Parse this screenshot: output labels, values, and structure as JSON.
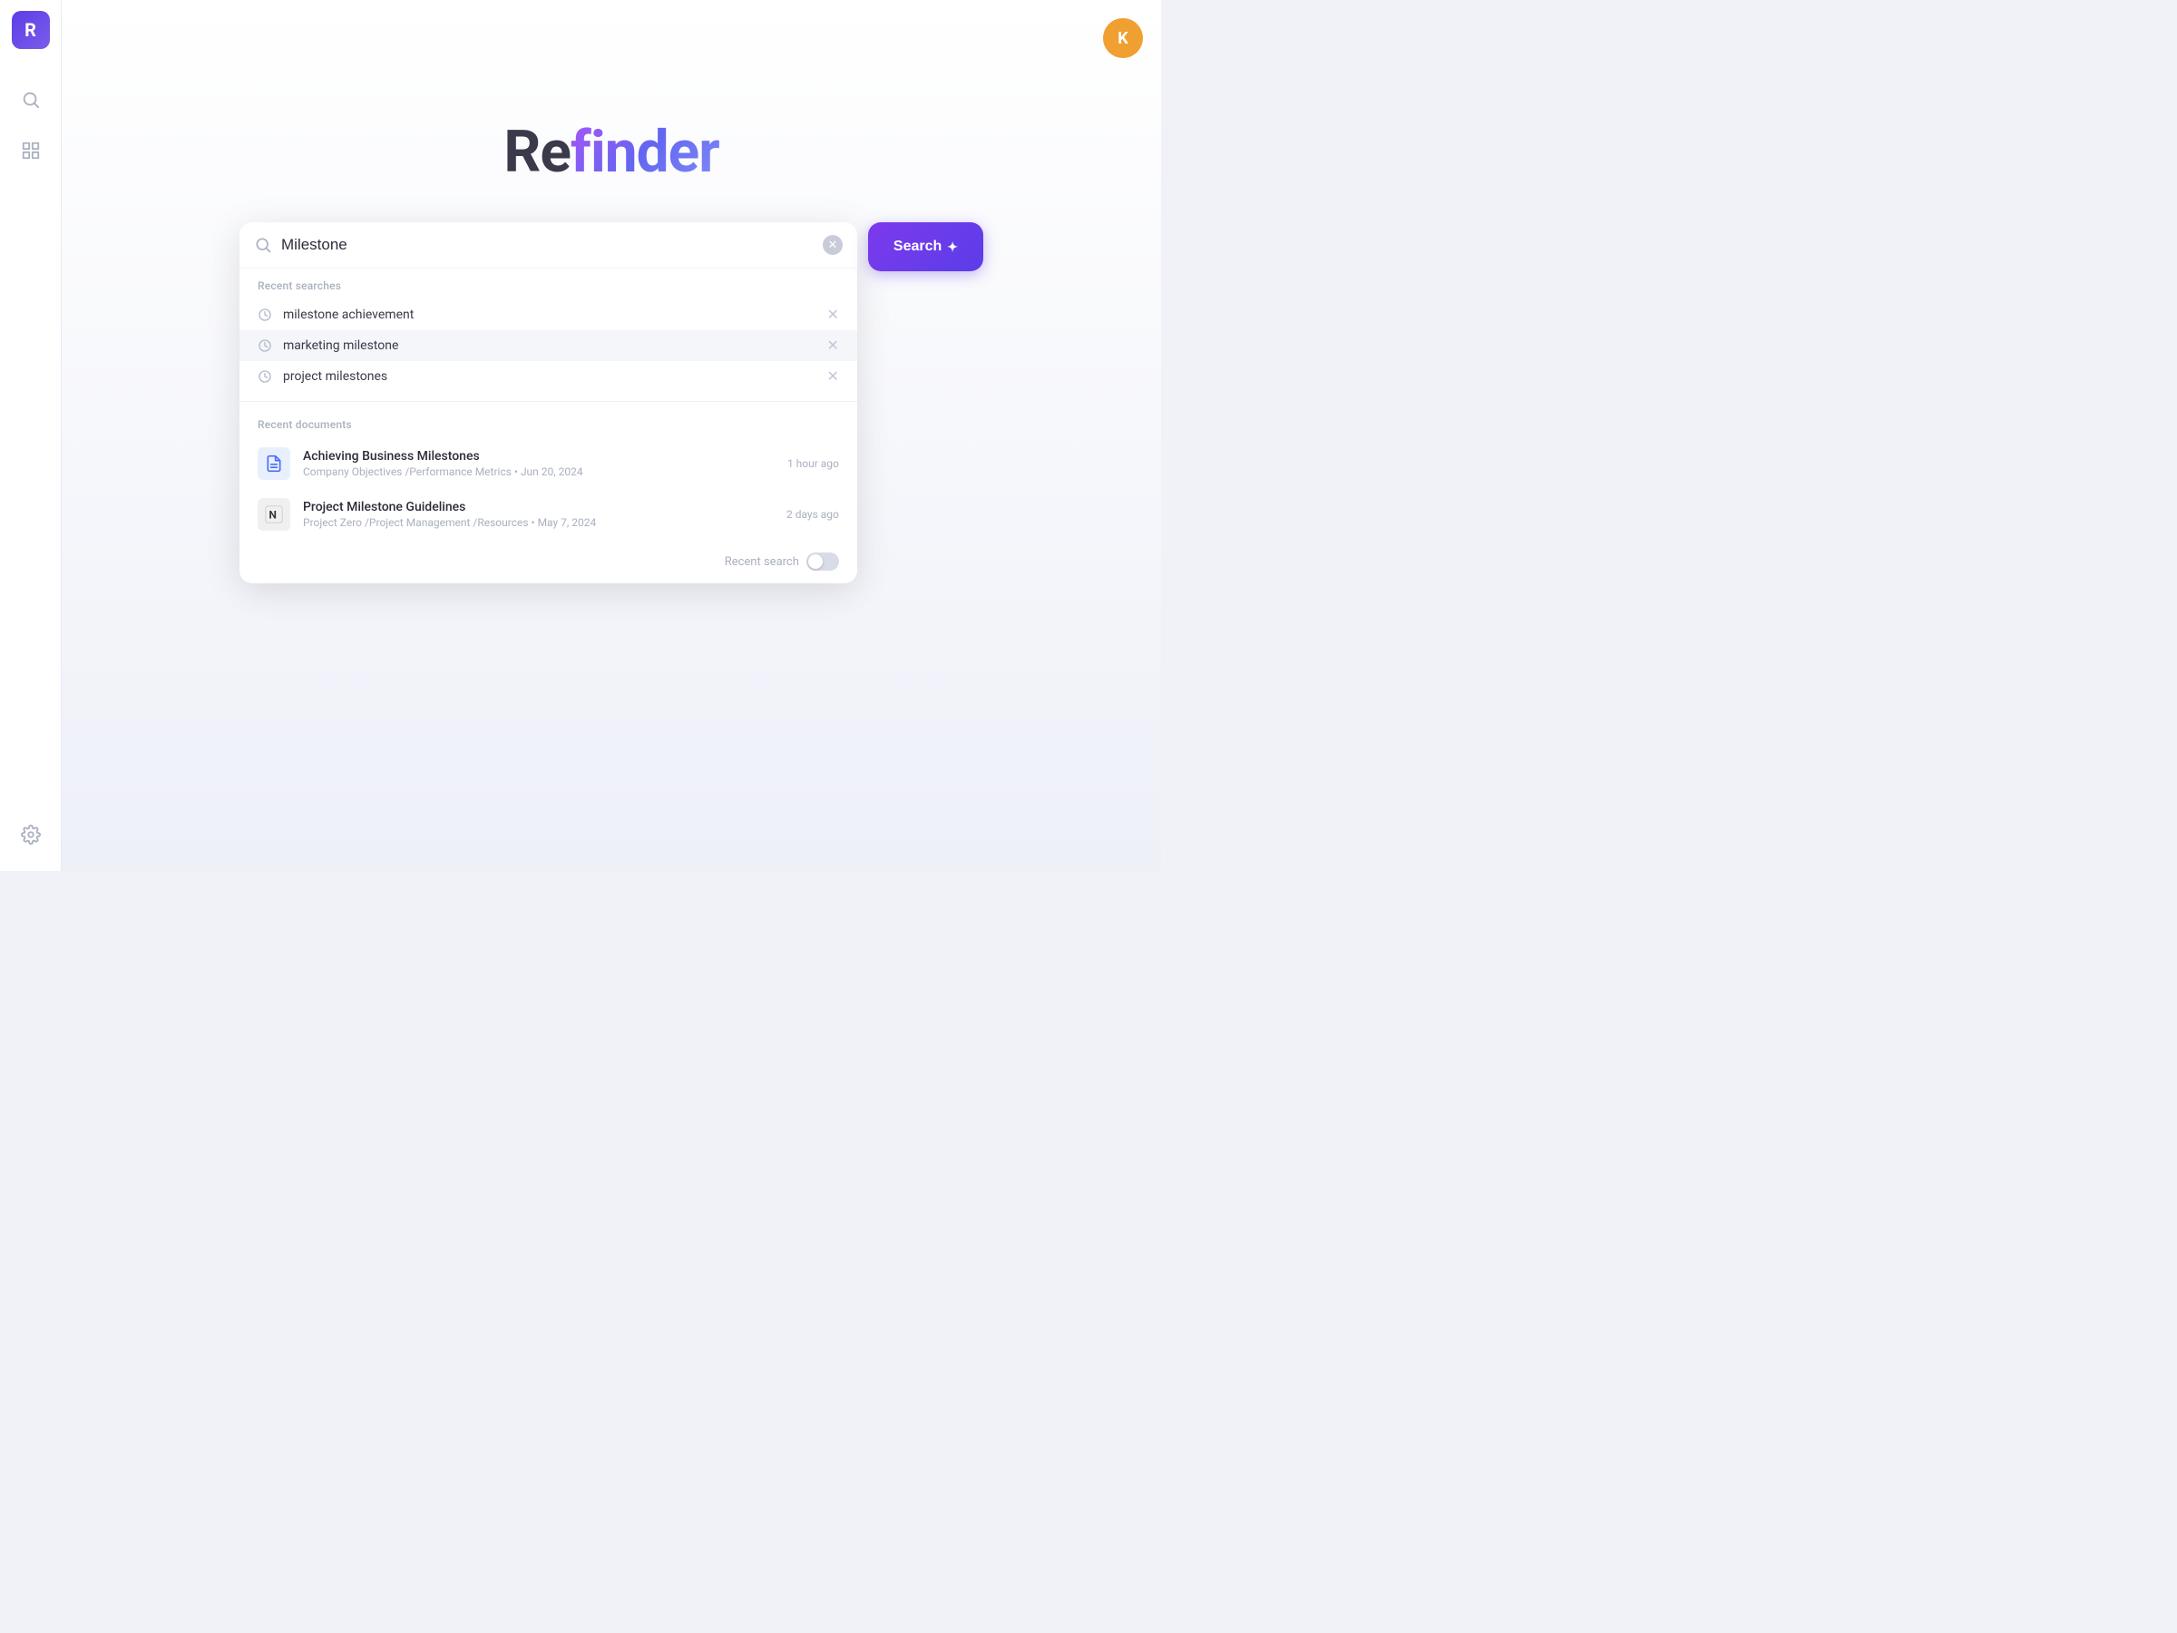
{
  "sidebar": {
    "logo_letter": "R",
    "icons": [
      {
        "name": "search-icon",
        "label": "Search"
      },
      {
        "name": "grid-icon",
        "label": "Grid"
      },
      {
        "name": "settings-icon",
        "label": "Settings"
      }
    ]
  },
  "header": {
    "user_initial": "K"
  },
  "logo": {
    "re": "Re",
    "finder": "finder"
  },
  "search": {
    "input_value": "Milestone",
    "button_label": "Search",
    "button_sparkle": "✦"
  },
  "recent_searches": {
    "section_label": "Recent searches",
    "items": [
      {
        "text": "milestone achievement"
      },
      {
        "text": "marketing milestone"
      },
      {
        "text": "project milestones"
      }
    ]
  },
  "recent_documents": {
    "section_label": "Recent documents",
    "items": [
      {
        "title": "Achieving Business Milestones",
        "path": "Company Objectives /Performance Metrics",
        "date": "Jun 20, 2024",
        "time_ago": "1 hour ago",
        "icon_type": "doc"
      },
      {
        "title": "Project Milestone Guidelines",
        "path": "Project Zero /Project Management /Resources",
        "date": "May 7, 2024",
        "time_ago": "2 days ago",
        "icon_type": "notion"
      }
    ]
  },
  "footer": {
    "recent_search_label": "Recent search"
  }
}
